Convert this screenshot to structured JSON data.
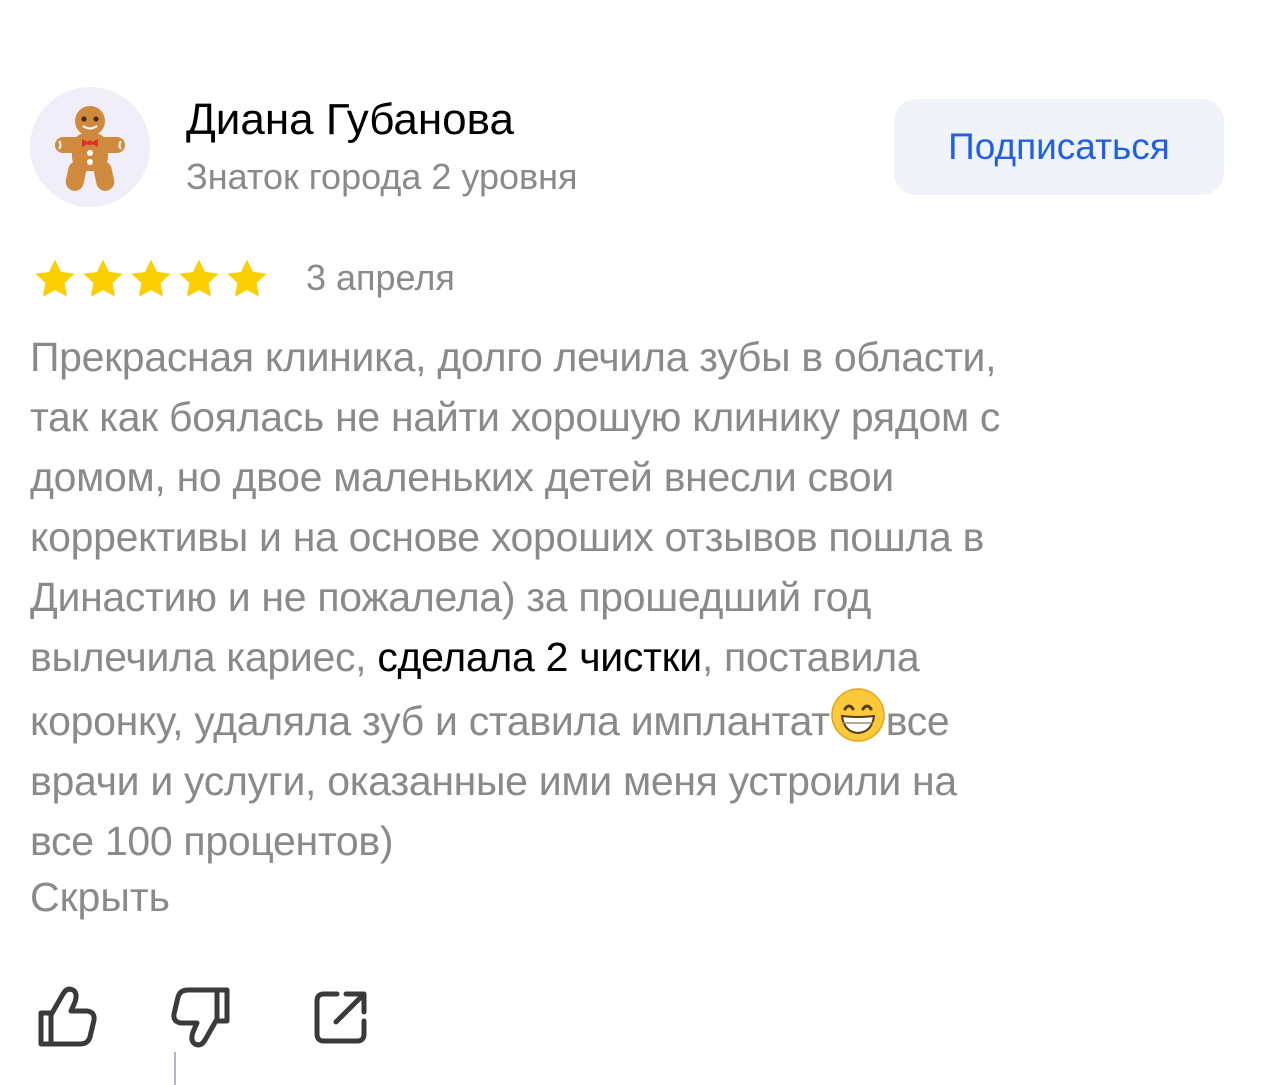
{
  "author": {
    "name": "Диана Губанова",
    "level": "Знаток города 2 уровня",
    "avatar_icon": "gingerbread-man-icon"
  },
  "subscribe": {
    "label": "Подписаться",
    "color": "#2260e3"
  },
  "review": {
    "rating": 5,
    "max_rating": 5,
    "date": "3 апреля",
    "text": {
      "line1": "Прекрасная клиника, долго лечила зубы в области,",
      "line2": "так как боялась не найти хорошую клинику рядом с",
      "line3": "домом, но двое маленьких детей внесли свои",
      "line4": "коррективы и на основе хороших отзывов пошла в",
      "line5": "Династию и не пожалела) за прошедший год",
      "line6_before": "вылечила кариес, ",
      "line6_highlight": "сделала 2 чистки",
      "line6_after": ", поставила",
      "line7_before": "коронку, удаляла зуб и ставила имплантат",
      "line7_emoji": "grinning-face-icon",
      "line7_after": "все",
      "line8": "врачи и услуги, оказанные ими меня устроили на",
      "line9": "все 100 процентов)"
    },
    "hide_label": "Скрыть"
  },
  "actions": {
    "like_icon": "thumbs-up-icon",
    "dislike_icon": "thumbs-down-icon",
    "share_icon": "share-icon"
  },
  "colors": {
    "star": "#fcd000",
    "text_gray": "#8a8a8a",
    "highlight": "#000000"
  }
}
